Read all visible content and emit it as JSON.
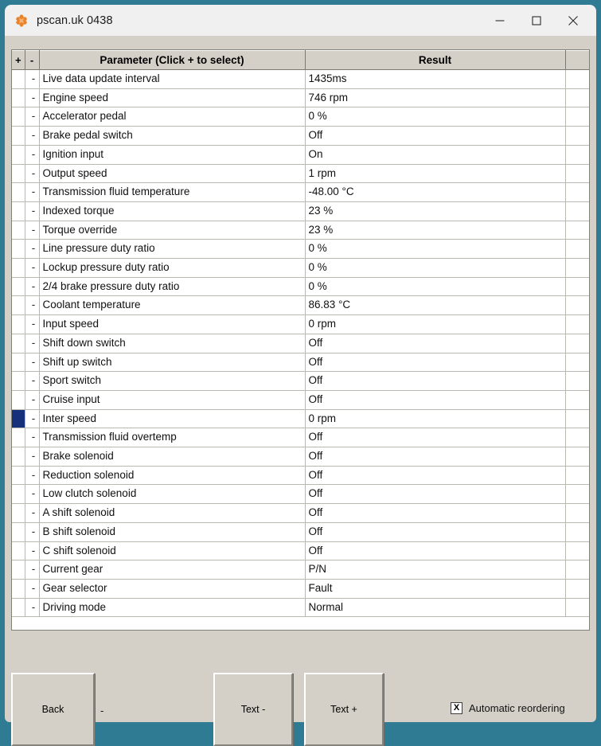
{
  "window": {
    "title": "pscan.uk 0438",
    "icon": "app-star-icon",
    "accent_border": "#2e7b93",
    "titlebar_bg": "#f0f0f0",
    "client_bg": "#d4d0c8",
    "controls": [
      {
        "name": "minimize",
        "glyph": "minimize-icon"
      },
      {
        "name": "maximize",
        "glyph": "maximize-icon"
      },
      {
        "name": "close",
        "glyph": "close-icon"
      }
    ]
  },
  "grid": {
    "headers": {
      "plus": "+",
      "minus": "-",
      "parameter": "Parameter (Click + to select)",
      "result": "Result",
      "pad": ""
    },
    "selection_color": "#16307c",
    "rows": [
      {
        "plus": "",
        "minus": "-",
        "parameter": "Live data update interval",
        "result": "1435ms",
        "selected": false
      },
      {
        "plus": "",
        "minus": "-",
        "parameter": "Engine speed",
        "result": "746 rpm",
        "selected": false
      },
      {
        "plus": "",
        "minus": "-",
        "parameter": "Accelerator pedal",
        "result": "0 %",
        "selected": false
      },
      {
        "plus": "",
        "minus": "-",
        "parameter": "Brake pedal switch",
        "result": "Off",
        "selected": false
      },
      {
        "plus": "",
        "minus": "-",
        "parameter": "Ignition input",
        "result": "On",
        "selected": false
      },
      {
        "plus": "",
        "minus": "-",
        "parameter": "Output speed",
        "result": "1 rpm",
        "selected": false
      },
      {
        "plus": "",
        "minus": "-",
        "parameter": "Transmission fluid temperature",
        "result": "-48.00 °C",
        "selected": false
      },
      {
        "plus": "",
        "minus": "-",
        "parameter": "Indexed torque",
        "result": "23 %",
        "selected": false
      },
      {
        "plus": "",
        "minus": "-",
        "parameter": "Torque override",
        "result": "23 %",
        "selected": false
      },
      {
        "plus": "",
        "minus": "-",
        "parameter": "Line pressure duty ratio",
        "result": "0 %",
        "selected": false
      },
      {
        "plus": "",
        "minus": "-",
        "parameter": "Lockup pressure duty ratio",
        "result": "0 %",
        "selected": false
      },
      {
        "plus": "",
        "minus": "-",
        "parameter": "2/4 brake pressure duty ratio",
        "result": "0 %",
        "selected": false
      },
      {
        "plus": "",
        "minus": "-",
        "parameter": "Coolant temperature",
        "result": "86.83 °C",
        "selected": false
      },
      {
        "plus": "",
        "minus": "-",
        "parameter": "Input speed",
        "result": "0 rpm",
        "selected": false
      },
      {
        "plus": "",
        "minus": "-",
        "parameter": "Shift down switch",
        "result": "Off",
        "selected": false
      },
      {
        "plus": "",
        "minus": "-",
        "parameter": "Shift up switch",
        "result": "Off",
        "selected": false
      },
      {
        "plus": "",
        "minus": "-",
        "parameter": "Sport switch",
        "result": "Off",
        "selected": false
      },
      {
        "plus": "",
        "minus": "-",
        "parameter": "Cruise input",
        "result": "Off",
        "selected": false
      },
      {
        "plus": "",
        "minus": "-",
        "parameter": "Inter speed",
        "result": "0 rpm",
        "selected": true
      },
      {
        "plus": "",
        "minus": "-",
        "parameter": "Transmission fluid overtemp",
        "result": "Off",
        "selected": false
      },
      {
        "plus": "",
        "minus": "-",
        "parameter": "Brake solenoid",
        "result": "Off",
        "selected": false
      },
      {
        "plus": "",
        "minus": "-",
        "parameter": "Reduction solenoid",
        "result": "Off",
        "selected": false
      },
      {
        "plus": "",
        "minus": "-",
        "parameter": "Low clutch solenoid",
        "result": "Off",
        "selected": false
      },
      {
        "plus": "",
        "minus": "-",
        "parameter": "A shift solenoid",
        "result": "Off",
        "selected": false
      },
      {
        "plus": "",
        "minus": "-",
        "parameter": "B shift solenoid",
        "result": "Off",
        "selected": false
      },
      {
        "plus": "",
        "minus": "-",
        "parameter": "C shift solenoid",
        "result": "Off",
        "selected": false
      },
      {
        "plus": "",
        "minus": "-",
        "parameter": "Current gear",
        "result": "P/N",
        "selected": false
      },
      {
        "plus": "",
        "minus": "-",
        "parameter": "Gear selector",
        "result": "Fault",
        "selected": false
      },
      {
        "plus": "",
        "minus": "-",
        "parameter": "Driving mode",
        "result": "Normal",
        "selected": false
      }
    ]
  },
  "bottom": {
    "back_label": "Back",
    "dash_label": "-",
    "text_minus_label": "Text -",
    "text_plus_label": "Text +",
    "reorder_checkbox_mark": "X",
    "reorder_label": "Automatic reordering",
    "reorder_checked": true
  }
}
